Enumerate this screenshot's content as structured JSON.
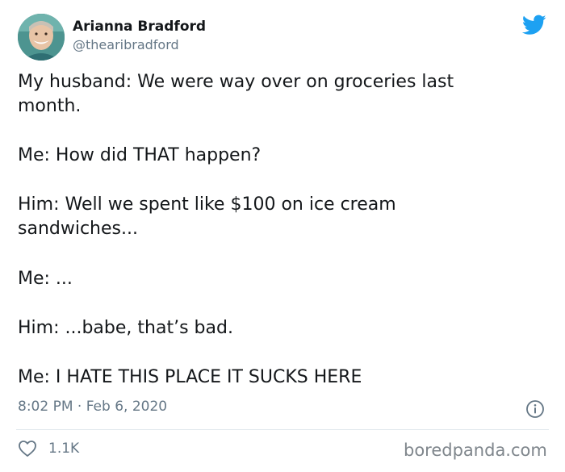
{
  "author": {
    "name": "Arianna Bradford",
    "handle": "@thearibradford",
    "avatar_icon": "avatar-photo",
    "verified": false
  },
  "platform_icon": "twitter-bird-icon",
  "brand_color": "#1da1f2",
  "tweet": {
    "lines": [
      "My husband: We were way over on groceries last",
      "month.",
      "Me: How did THAT happen?",
      "Him: Well we spent like $100 on ice cream",
      "sandwiches...",
      "Me: ...",
      "Him: ...babe, that’s bad.",
      "Me: I HATE THIS PLACE IT SUCKS HERE"
    ]
  },
  "meta": {
    "timestamp": "8:02 PM · Feb 6, 2020",
    "info_icon": "info-icon"
  },
  "engagement": {
    "likes_icon": "heart-icon",
    "likes": "1.1K"
  },
  "watermark": "boredpanda.com"
}
